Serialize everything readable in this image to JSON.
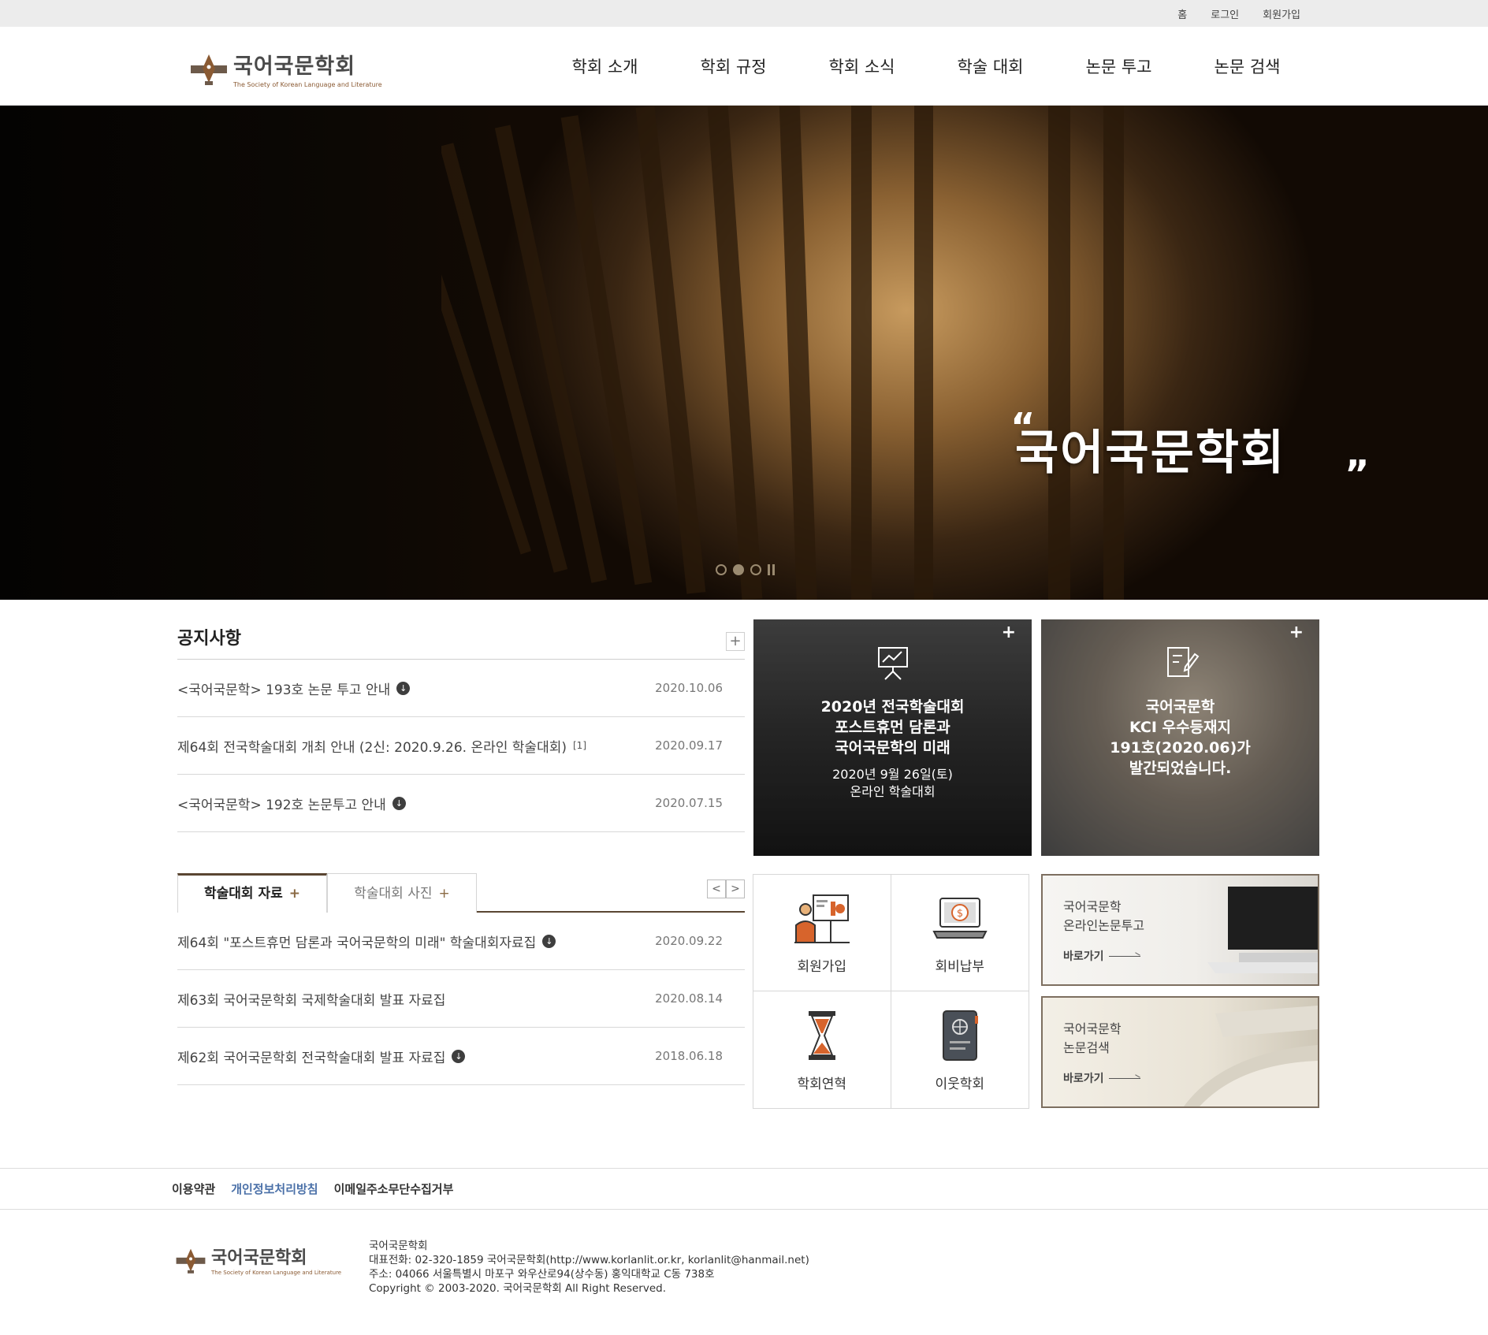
{
  "topbar": {
    "home": "홈",
    "login": "로그인",
    "signup": "회원가입"
  },
  "header": {
    "logo_kr": "국어국문학회",
    "logo_en": "The Society of Korean Language and Literature",
    "nav": [
      "학회 소개",
      "학회 규정",
      "학회 소식",
      "학술 대회",
      "논문 투고",
      "논문 검색"
    ]
  },
  "hero": {
    "quote": "국어국문학회"
  },
  "notice": {
    "title": "공지사항",
    "more": "+",
    "items": [
      {
        "title": "<국어국문학> 193호 논문 투고 안내",
        "date": "2020.10.06",
        "download": true
      },
      {
        "title": "제64회 전국학술대회 개최 안내 (2신: 2020.9.26. 온라인 학술대회)",
        "badge": "[1]",
        "date": "2020.09.17"
      },
      {
        "title": "<국어국문학> 192호 논문투고 안내",
        "date": "2020.07.15",
        "download": true
      }
    ]
  },
  "seminar": {
    "tabs": [
      "학술대회 자료",
      "학술대회 사진"
    ],
    "tab_plus": "+",
    "prev": "<",
    "next": ">",
    "items": [
      {
        "title": "제64회 \"포스트휴먼 담론과 국어국문학의 미래\" 학술대회자료집",
        "date": "2020.09.22",
        "download": true
      },
      {
        "title": "제63회 국어국문학회 국제학술대회 발표 자료집",
        "date": "2020.08.14"
      },
      {
        "title": "제62회 국어국문학회 전국학술대회 발표 자료집",
        "date": "2018.06.18",
        "download": true
      }
    ]
  },
  "tiles": {
    "conference": {
      "plus": "+",
      "lines": [
        "2020년 전국학술대회",
        "포스트휴먼 담론과",
        "국어국문학의 미래"
      ],
      "sub": [
        "2020년 9월 26일(토)",
        "온라인 학술대회"
      ]
    },
    "journal": {
      "plus": "+",
      "lines": [
        "국어국문학",
        "KCI 우수등재지",
        "191호(2020.06)가",
        "발간되었습니다."
      ]
    }
  },
  "quick": [
    {
      "label": "회원가입",
      "icon": "presentation-icon"
    },
    {
      "label": "회비납부",
      "icon": "laptop-money-icon"
    },
    {
      "label": "학회연혁",
      "icon": "hourglass-icon"
    },
    {
      "label": "이웃학회",
      "icon": "book-globe-icon"
    }
  ],
  "banners": [
    {
      "line1": "국어국문학",
      "line2": "온라인논문투고",
      "go": "바로가기"
    },
    {
      "line1": "국어국문학",
      "line2": "논문검색",
      "go": "바로가기"
    }
  ],
  "footer": {
    "links": [
      "이용약관",
      "개인정보처리방침",
      "이메일주소무단수집거부"
    ],
    "org": "국어국문학회",
    "tel": "대표전화: 02-320-1859 국어국문학회(http://www.korlanlit.or.kr, korlanlit@hanmail.net)",
    "addr": "주소: 04066 서울특별시 마포구 와우산로94(상수동) 홍익대학교 C동 738호",
    "copy": "Copyright © 2003-2020. 국어국문학회 All Right Reserved."
  },
  "colors": {
    "accent": "#5a4632",
    "link_blue": "#4a70a8",
    "brand_brown": "#8a5a33"
  }
}
